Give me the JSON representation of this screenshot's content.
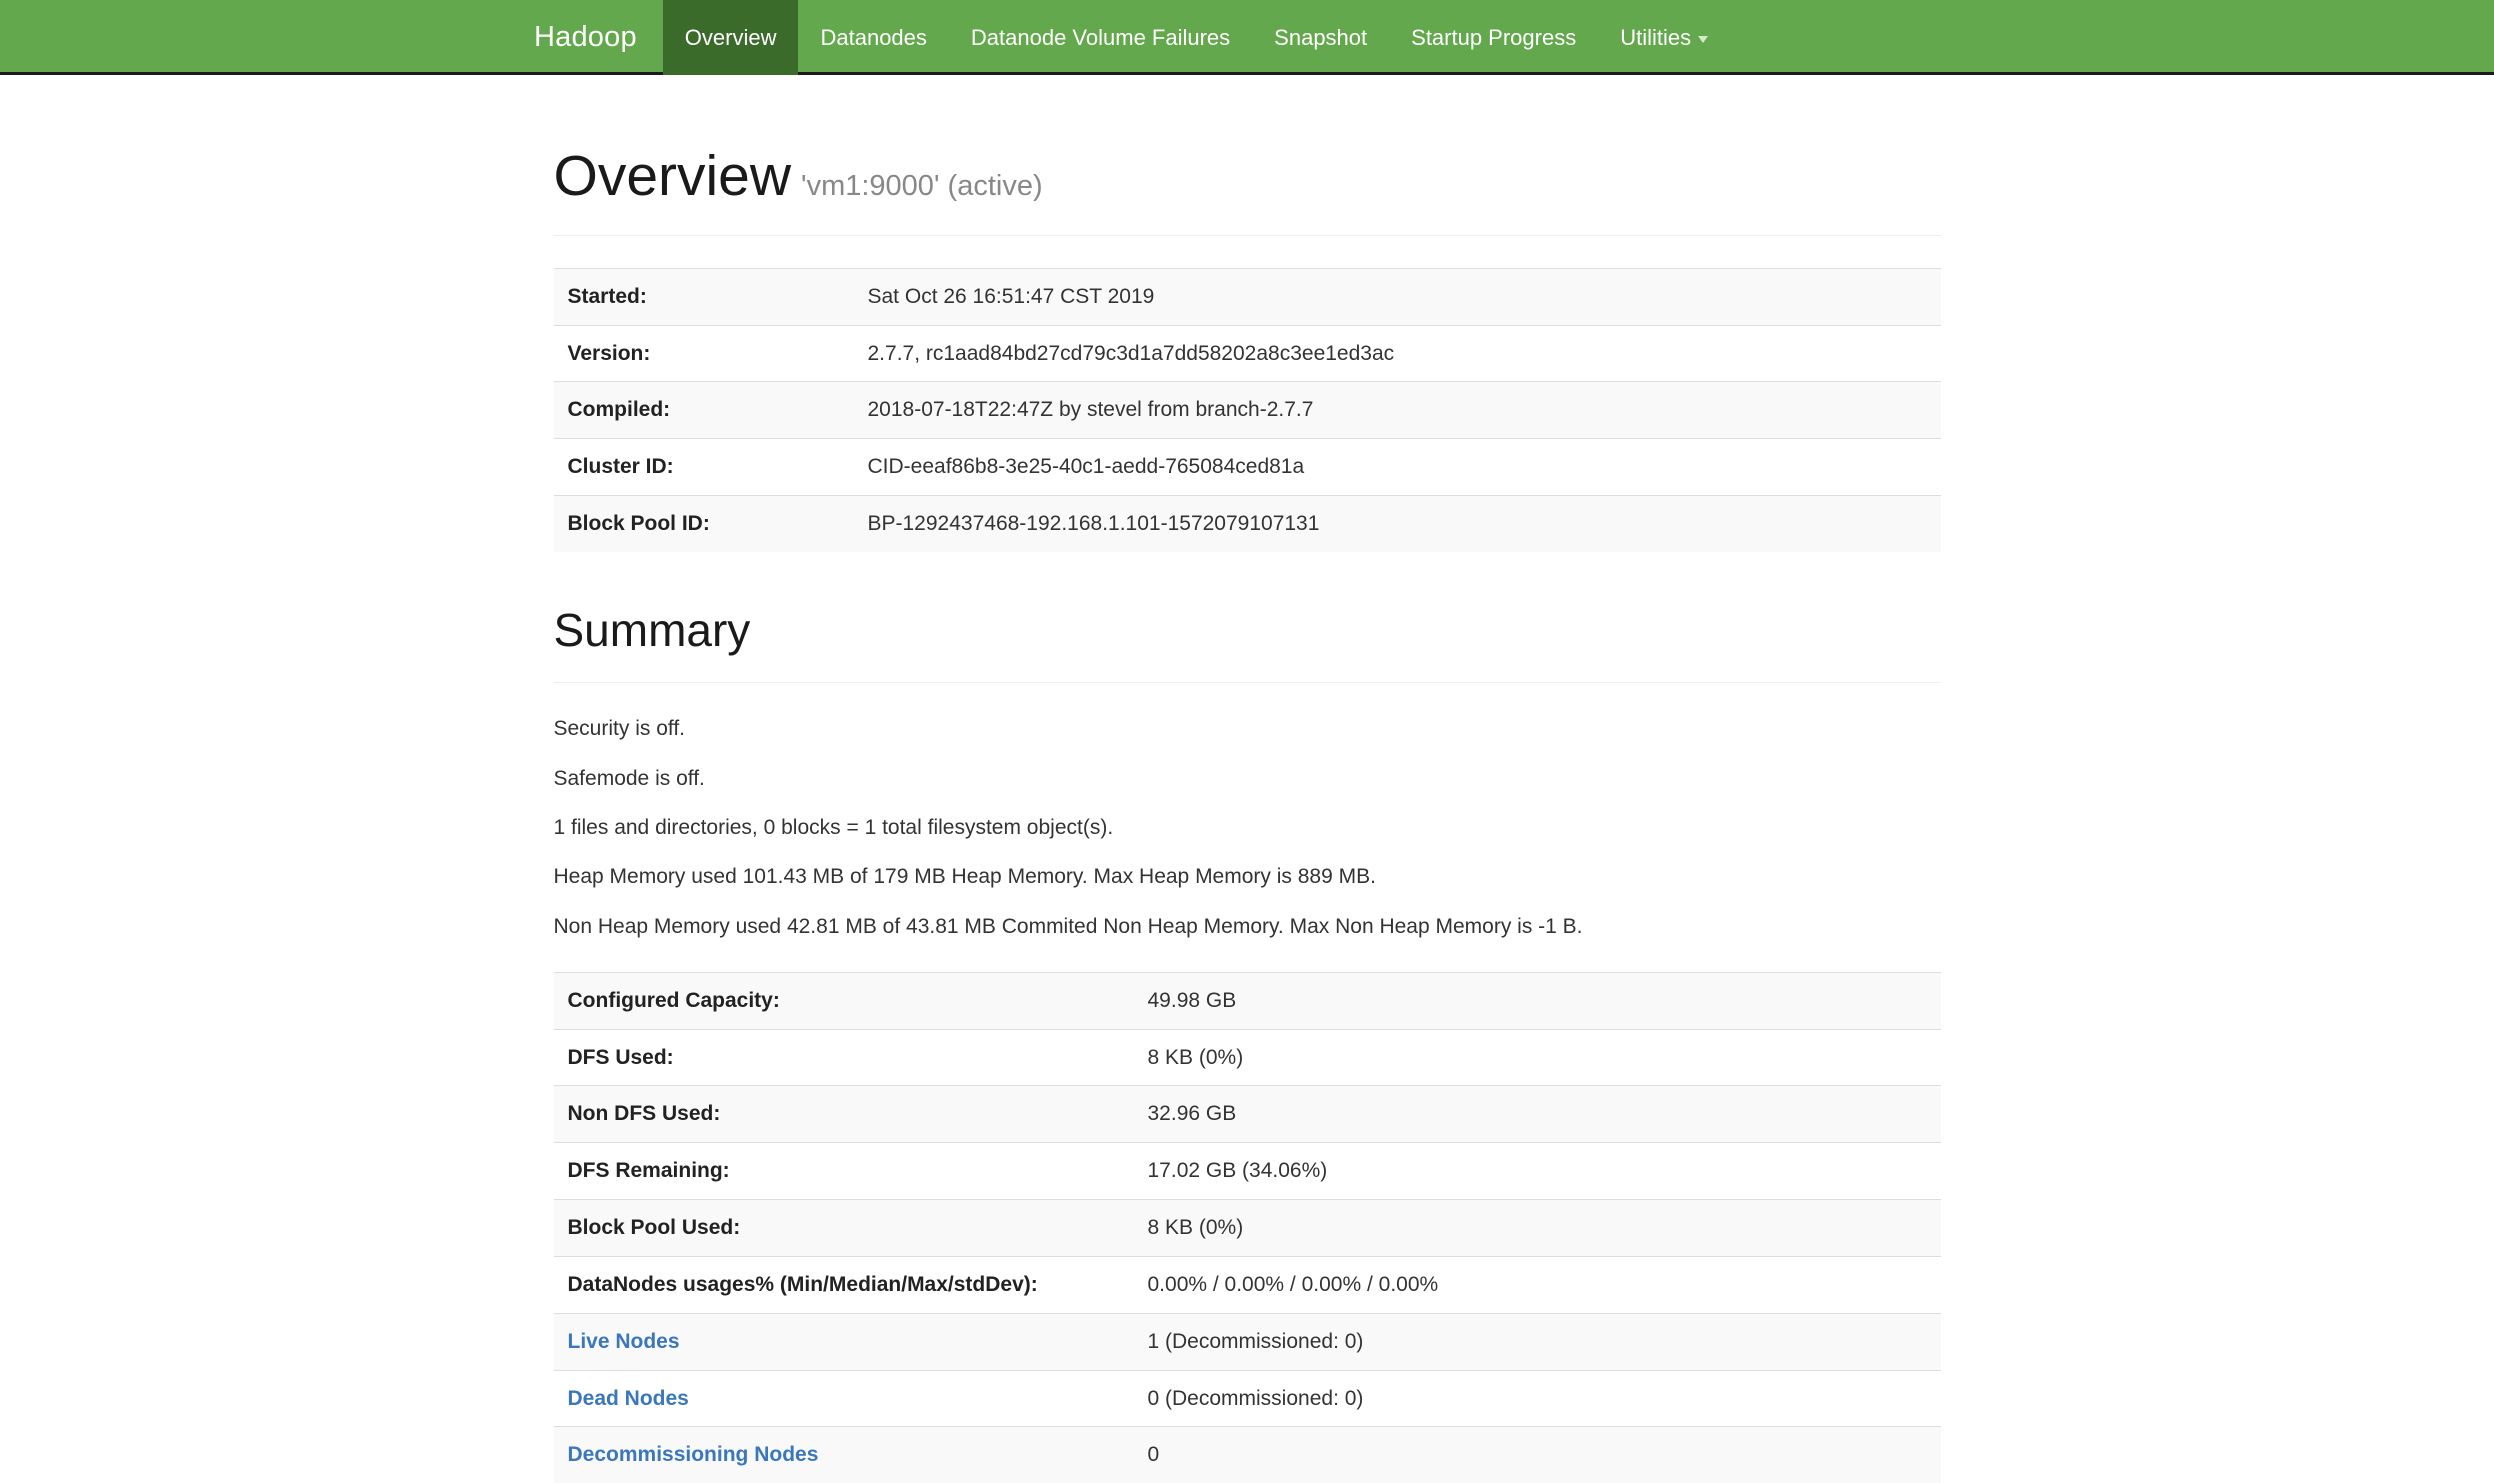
{
  "navbar": {
    "brand": "Hadoop",
    "items": [
      {
        "label": "Overview",
        "active": true,
        "caret": false
      },
      {
        "label": "Datanodes",
        "active": false,
        "caret": false
      },
      {
        "label": "Datanode Volume Failures",
        "active": false,
        "caret": false
      },
      {
        "label": "Snapshot",
        "active": false,
        "caret": false
      },
      {
        "label": "Startup Progress",
        "active": false,
        "caret": false
      },
      {
        "label": "Utilities",
        "active": false,
        "caret": true
      }
    ],
    "colors": {
      "background": "#63a84c",
      "active_background": "#3b6b2b",
      "text": "#ffffff"
    }
  },
  "page": {
    "title": "Overview",
    "subtitle": "'vm1:9000' (active)"
  },
  "overview_table": {
    "rows": [
      {
        "key": "Started:",
        "value": "Sat Oct 26 16:51:47 CST 2019"
      },
      {
        "key": "Version:",
        "value": "2.7.7, rc1aad84bd27cd79c3d1a7dd58202a8c3ee1ed3ac"
      },
      {
        "key": "Compiled:",
        "value": "2018-07-18T22:47Z by stevel from branch-2.7.7"
      },
      {
        "key": "Cluster ID:",
        "value": "CID-eeaf86b8-3e25-40c1-aedd-765084ced81a"
      },
      {
        "key": "Block Pool ID:",
        "value": "BP-1292437468-192.168.1.101-1572079107131"
      }
    ]
  },
  "summary": {
    "title": "Summary",
    "lines": [
      "Security is off.",
      "Safemode is off.",
      "1 files and directories, 0 blocks = 1 total filesystem object(s).",
      "Heap Memory used 101.43 MB of 179 MB Heap Memory. Max Heap Memory is 889 MB.",
      "Non Heap Memory used 42.81 MB of 43.81 MB Commited Non Heap Memory. Max Non Heap Memory is -1 B."
    ],
    "rows": [
      {
        "key": "Configured Capacity:",
        "value": "49.98 GB",
        "link": false
      },
      {
        "key": "DFS Used:",
        "value": "8 KB (0%)",
        "link": false
      },
      {
        "key": "Non DFS Used:",
        "value": "32.96 GB",
        "link": false
      },
      {
        "key": "DFS Remaining:",
        "value": "17.02 GB (34.06%)",
        "link": false
      },
      {
        "key": "Block Pool Used:",
        "value": "8 KB (0%)",
        "link": false
      },
      {
        "key": "DataNodes usages% (Min/Median/Max/stdDev):",
        "value": "0.00% / 0.00% / 0.00% / 0.00%",
        "link": false
      },
      {
        "key": "Live Nodes",
        "value": "1 (Decommissioned: 0)",
        "link": true
      },
      {
        "key": "Dead Nodes",
        "value": "0 (Decommissioned: 0)",
        "link": true
      },
      {
        "key": "Decommissioning Nodes",
        "value": "0",
        "link": true
      }
    ]
  }
}
